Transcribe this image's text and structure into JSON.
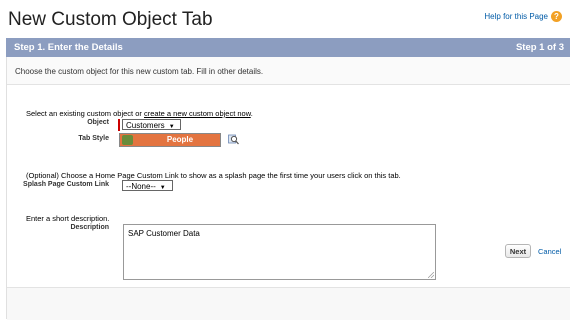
{
  "page": {
    "title": "New Custom Object Tab",
    "help_link": "Help for this Page"
  },
  "step": {
    "title": "Step 1. Enter the Details",
    "counter": "Step 1 of 3"
  },
  "intro": "Choose the custom object for this new custom tab. Fill in other details.",
  "object_section": {
    "prompt_prefix": "Select an existing custom object or ",
    "prompt_link": "create a new custom object now",
    "prompt_suffix": ".",
    "object_label": "Object",
    "object_value": "Customers",
    "tabstyle_label": "Tab Style",
    "tabstyle_value": "People"
  },
  "splash_section": {
    "prompt": "(Optional) Choose a Home Page Custom Link to show as a splash page the first time your users click on this tab.",
    "label": "Splash Page Custom Link",
    "value": "--None--"
  },
  "description_section": {
    "prompt": "Enter a short description.",
    "label": "Description",
    "value": "SAP Customer Data"
  },
  "footer": {
    "next_label": "Next",
    "cancel_label": "Cancel"
  },
  "colors": {
    "step_bar": "#8c9dc0",
    "tab_style": "#e37440",
    "required": "#cc0000",
    "link": "#015ba7"
  }
}
